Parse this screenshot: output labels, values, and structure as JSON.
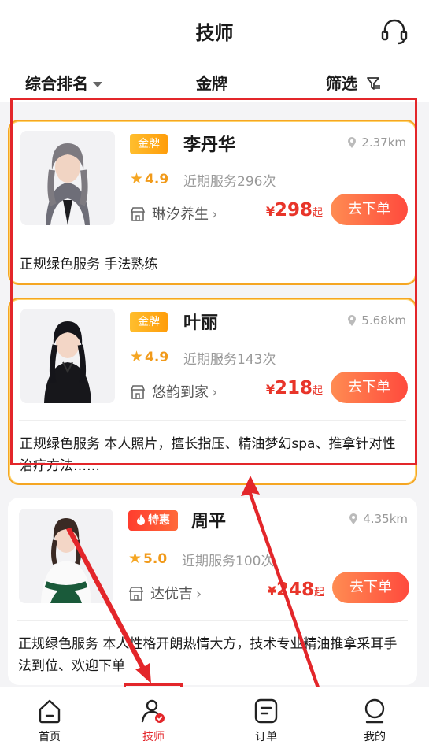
{
  "header": {
    "title": "技师",
    "support_icon": "headset-icon"
  },
  "sortbar": {
    "sort": "综合排名",
    "gold": "金牌",
    "filter": "筛选"
  },
  "cards": [
    {
      "badge": "金牌",
      "name": "李丹华",
      "distance": "2.37km",
      "rating": "4.9",
      "served": "近期服务296次",
      "shop": "琳汐养生",
      "price_symbol": "¥",
      "price": "298",
      "price_suffix": "起",
      "order_label": "去下单",
      "desc": "正规绿色服务 手法熟练"
    },
    {
      "badge": "金牌",
      "name": "叶丽",
      "distance": "5.68km",
      "rating": "4.9",
      "served": "近期服务143次",
      "shop": "悠韵到家",
      "price_symbol": "¥",
      "price": "218",
      "price_suffix": "起",
      "order_label": "去下单",
      "desc": "正规绿色服务 本人照片，擅长指压、精油梦幻spa、推拿针对性治疗方法……"
    },
    {
      "badge": "特惠",
      "name": "周平",
      "distance": "4.35km",
      "rating": "5.0",
      "served": "近期服务100次",
      "shop": "达优吉",
      "price_symbol": "¥",
      "price": "248",
      "price_suffix": "起",
      "order_label": "去下单",
      "desc": "正规绿色服务 本人性格开朗热情大方，技术专业精油推拿采耳手法到位、欢迎下单"
    }
  ],
  "tabs": [
    {
      "label": "首页",
      "icon": "home-icon"
    },
    {
      "label": "技师",
      "icon": "technician-icon",
      "active": true
    },
    {
      "label": "订单",
      "icon": "order-icon"
    },
    {
      "label": "我的",
      "icon": "profile-icon"
    }
  ],
  "colors": {
    "accent": "#e3262a",
    "price": "#e8352a",
    "gold": "#f5a623",
    "button_from": "#ff8c52",
    "button_to": "#ff4a3d"
  }
}
